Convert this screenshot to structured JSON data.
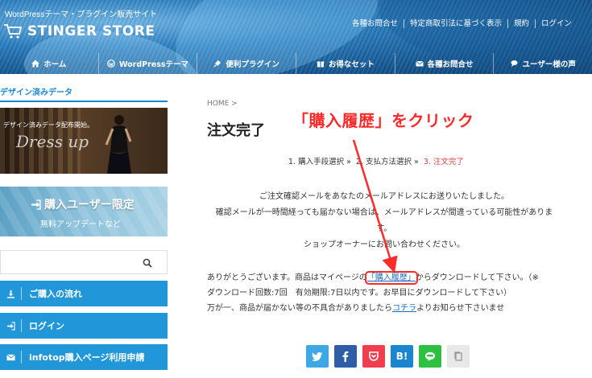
{
  "header": {
    "tagline": "WordPressテーマ・プラグイン販売サイト",
    "site_name": "STINGER STORE",
    "top_links": [
      "各種お問合せ",
      "特定商取引法に基づく表示",
      "規約",
      "ログイン"
    ],
    "nav": [
      {
        "label": "ホーム",
        "icon": "home-icon"
      },
      {
        "label": "WordPressテーマ",
        "icon": "wordpress-icon"
      },
      {
        "label": "便利プラグイン",
        "icon": "plug-icon"
      },
      {
        "label": "お得なセット",
        "icon": "gift-icon"
      },
      {
        "label": "各種お問合せ",
        "icon": "envelope-icon"
      },
      {
        "label": "ユーザー様の声",
        "icon": "comments-icon"
      }
    ]
  },
  "sidebar": {
    "heading": "デザイン済みデータ",
    "banner1": {
      "caption": "デザイン済みデータ配布開始。",
      "script": "Dress up"
    },
    "banner2": {
      "title": "購入ユーザー限定",
      "subtitle": "無料アップデートなど"
    },
    "search": {
      "placeholder": ""
    },
    "buttons": [
      {
        "label": "ご購入の流れ",
        "icon": "download-icon"
      },
      {
        "label": "ログイン",
        "icon": "sign-in-icon"
      },
      {
        "label": "infotop購入ページ利用申請",
        "icon": "envelope-icon"
      }
    ]
  },
  "main": {
    "breadcrumb": "HOME >",
    "title": "注文完了",
    "annotation": "「購入履歴」をクリック",
    "steps": {
      "step1": "1. 購入手段選択 »",
      "step2": "2. 支払方法選択 »",
      "step3": "3. 注文完了"
    },
    "message": {
      "line1": "ご注文確認メールをあなたのメールアドレスにお送りいたしました。",
      "line2": "確認メールが一時間経っても届かない場合は、メールアドレスが間違っている可能性がありま",
      "line3": "す。",
      "line4": "ショップオーナーにお問い合わせください。"
    },
    "thanks": {
      "part1": "ありがとうございます。商品はマイページの",
      "link1": "「購入履歴」",
      "part2": "からダウンロードして下さい。（※",
      "line2": "ダウンロード回数:7回　有効期限:7日以内です。お早目にダウンロードして下さい）",
      "part3": "万が一、商品が届かない等の不具合がありましたら",
      "link2": "コチラ",
      "part4": "よりお知らせ下さいませ"
    },
    "share": {
      "hatena_label": "B!"
    }
  },
  "colors": {
    "accent": "#2196d9",
    "annotation_red": "#ff2a2a",
    "current_step": "#e23b3b",
    "link": "#1a6fc4"
  }
}
